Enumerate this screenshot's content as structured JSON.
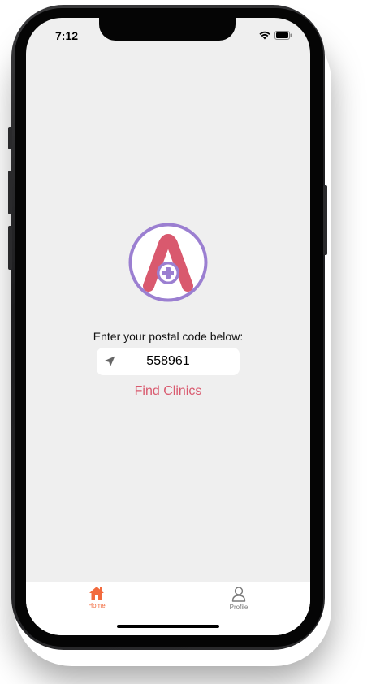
{
  "status_bar": {
    "time": "7:12",
    "signal": "....",
    "icons": [
      "wifi-icon",
      "battery-icon"
    ]
  },
  "logo": {
    "letter": "A",
    "icon": "medical-cross-icon"
  },
  "main": {
    "prompt": "Enter your postal code below:",
    "postal_code_value": "558961",
    "location_icon": "location-arrow-icon",
    "find_button_label": "Find Clinics"
  },
  "tabbar": {
    "tabs": [
      {
        "label": "Home",
        "icon": "home-icon",
        "active": true
      },
      {
        "label": "Profile",
        "icon": "user-icon",
        "active": false
      }
    ]
  },
  "colors": {
    "accent": "#d9596e",
    "logo_ring": "#9b7fd1",
    "active_tab": "#f26a3d",
    "inactive_tab": "#7a7a7a",
    "background": "#efefef"
  }
}
